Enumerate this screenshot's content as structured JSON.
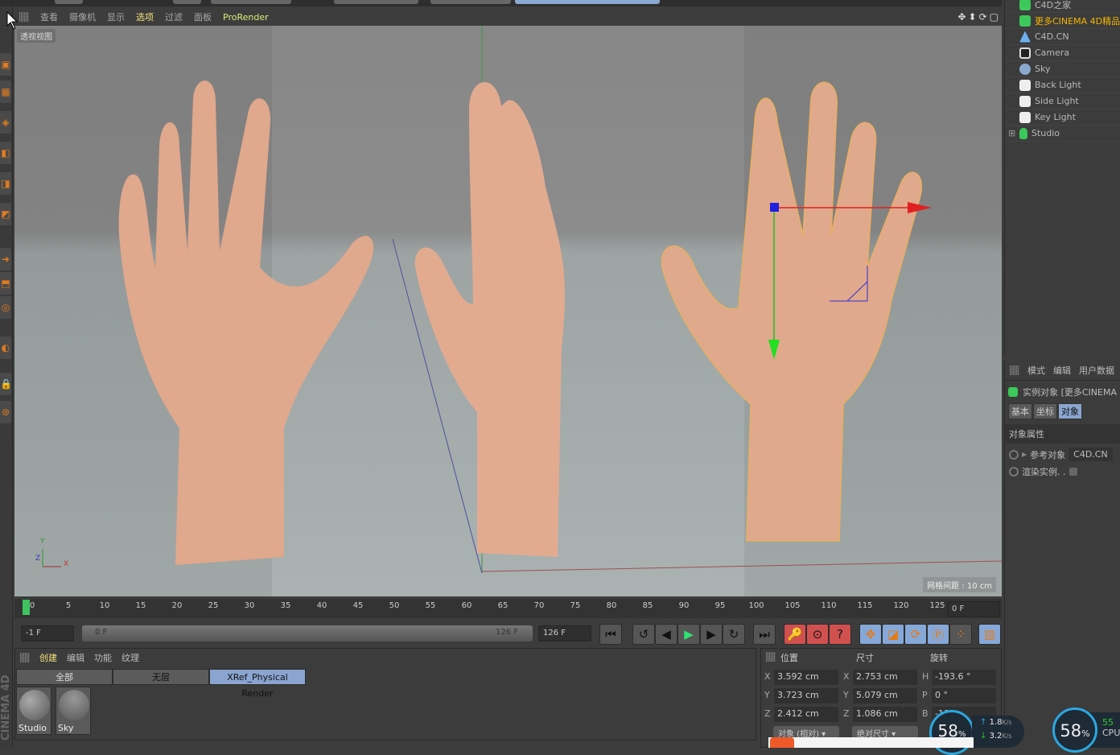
{
  "viewport_menu": {
    "items": [
      "查看",
      "摄像机",
      "显示",
      "选项",
      "过滤",
      "面板",
      "ProRender"
    ],
    "active": "选项"
  },
  "viewport": {
    "label": "透视视图",
    "grid_spacing": "网格间距 : 10 cm",
    "axis_z": "Z",
    "axis_y": "Y",
    "axis_x": "X"
  },
  "object_manager": {
    "items": [
      {
        "name": "C4D之家",
        "icon": "instance-icon",
        "color": "#3cc85a"
      },
      {
        "name": "更多CINEMA 4D精品",
        "icon": "instance-icon",
        "color": "#3cc85a",
        "highlight": true
      },
      {
        "name": "C4D.CN",
        "icon": "polygon-icon",
        "color": "#6ab0f0"
      },
      {
        "name": "Camera",
        "icon": "camera-icon",
        "color": "#dddddd"
      },
      {
        "name": "Sky",
        "icon": "sky-icon",
        "color": "#8aa8d0"
      },
      {
        "name": "Back Light",
        "icon": "light-icon",
        "color": "#eeeeee"
      },
      {
        "name": "Side Light",
        "icon": "light-icon",
        "color": "#eeeeee"
      },
      {
        "name": "Key Light",
        "icon": "light-icon",
        "color": "#eeeeee"
      },
      {
        "name": "Studio",
        "icon": "studio-icon",
        "color": "#3cc85a"
      }
    ]
  },
  "attributes": {
    "menu": [
      "模式",
      "编辑",
      "用户数据"
    ],
    "title": "实例对象 [更多CINEMA",
    "tabs": [
      "基本",
      "坐标",
      "对象"
    ],
    "active_tab": "对象",
    "section": "对象属性",
    "ref_label": "参考对象",
    "ref_value": "C4D.CN",
    "render_label": "渲染实例. ."
  },
  "timeline": {
    "ticks": [
      "0",
      "5",
      "10",
      "15",
      "20",
      "25",
      "30",
      "35",
      "40",
      "45",
      "50",
      "55",
      "60",
      "65",
      "70",
      "75",
      "80",
      "85",
      "90",
      "95",
      "100",
      "105",
      "110",
      "115",
      "120",
      "125"
    ],
    "current": "0 F",
    "start": "-1 F",
    "range_start": "0 F",
    "range_end": "126 F",
    "end": "126 F"
  },
  "materials": {
    "menu": [
      "创建",
      "编辑",
      "功能",
      "纹理"
    ],
    "active": "创建",
    "tabs": [
      "全部",
      "无层",
      "XRef_Physical Render"
    ],
    "items": [
      "Studio",
      "Sky"
    ]
  },
  "coords": {
    "headers": [
      "位置",
      "尺寸",
      "旋转"
    ],
    "rows": [
      {
        "a": "X",
        "pos": "3.592 cm",
        "b": "X",
        "size": "2.753 cm",
        "c": "H",
        "rot": "-193.6 °"
      },
      {
        "a": "Y",
        "pos": "3.723 cm",
        "b": "Y",
        "size": "5.079 cm",
        "c": "P",
        "rot": "0 °"
      },
      {
        "a": "Z",
        "pos": "2.412 cm",
        "b": "Z",
        "size": "1.086 cm",
        "c": "B",
        "rot": "-180"
      }
    ],
    "mode": "对象 (相对)",
    "size_mode": "绝对尺寸"
  },
  "widgets": {
    "cpu1": "58",
    "up": "1.8",
    "down": "3.2",
    "unit": "K/s",
    "cpu2": "58",
    "cpu_label": "CPU",
    "cpu_side": "55"
  },
  "logo": "CINEMA 4D"
}
